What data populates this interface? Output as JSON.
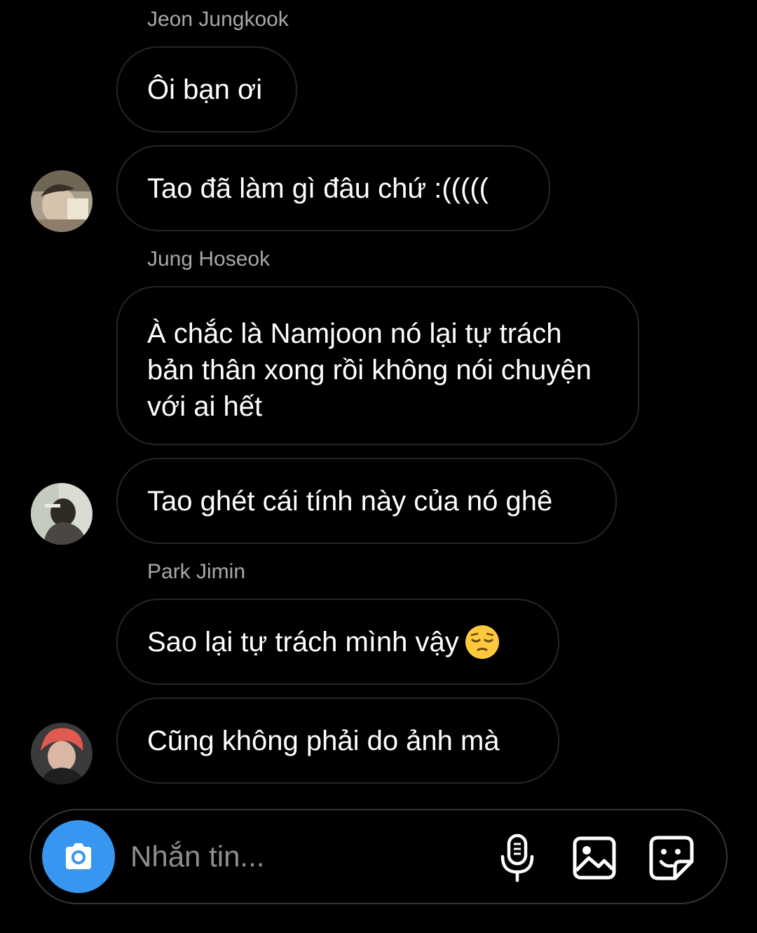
{
  "composer": {
    "placeholder": "Nhắn tin..."
  },
  "groups": [
    {
      "sender": "Jeon Jungkook",
      "messages": [
        "Ôi bạn ơi",
        "Tao đã làm gì đâu chứ :((((("
      ]
    },
    {
      "sender": "Jung Hoseok",
      "messages": [
        "À chắc là Namjoon nó lại tự trách bản thân xong rồi không nói chuyện với ai hết",
        "Tao ghét cái tính này của nó ghê"
      ]
    },
    {
      "sender": "Park Jimin",
      "messages": [
        "Sao lại tự trách mình vậy",
        "Cũng không phải do ảnh mà"
      ]
    }
  ],
  "icons": {
    "camera": "camera-icon",
    "microphone": "microphone-icon",
    "gallery": "gallery-icon",
    "sticker": "sticker-icon",
    "emoji": "pensive-face-emoji"
  },
  "colors": {
    "background": "#000000",
    "bubble_border": "#262626",
    "sender_name": "#a8a8a8",
    "camera_button": "#3797f0",
    "placeholder": "#8e8e8e"
  }
}
